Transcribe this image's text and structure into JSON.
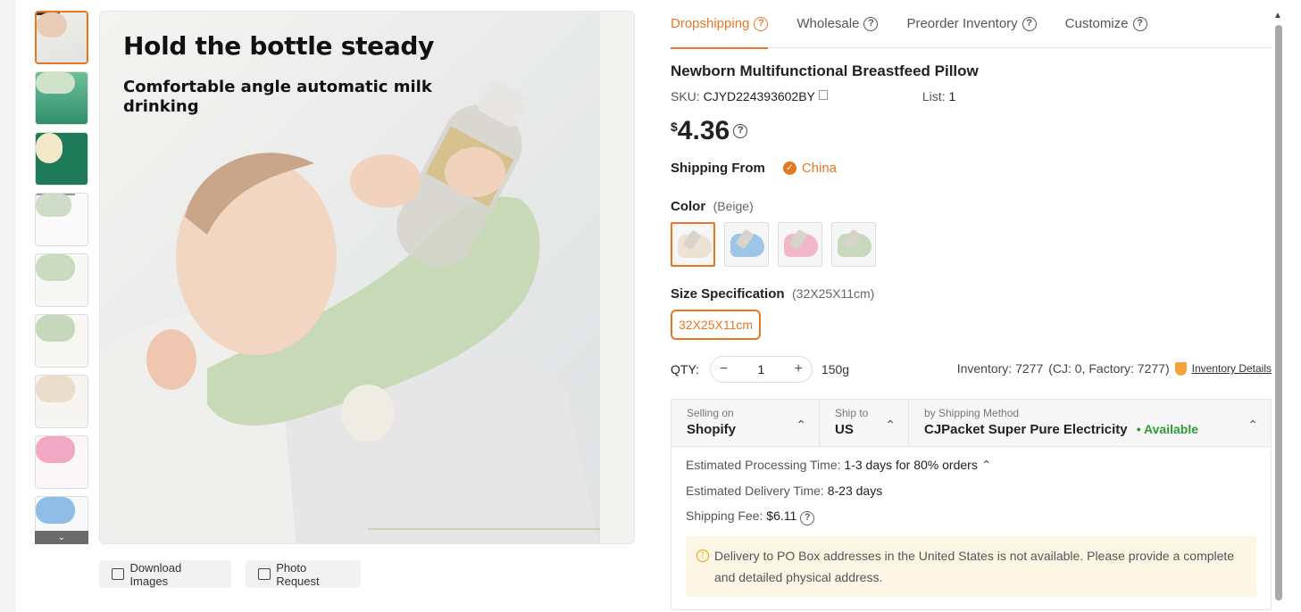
{
  "thumbnails": {
    "items": [
      "baby-bottle-holder",
      "green-pillow-shot",
      "dark-green-banner",
      "feature-sheet",
      "green-pillow-1",
      "green-pillow-2",
      "beige-pillow",
      "pink-pillow",
      "blue-pillow"
    ],
    "more_icon": "chevron-down-icon"
  },
  "main_image": {
    "headline": "Hold the bottle steady",
    "subtext": "Comfortable angle automatic milk drinking"
  },
  "image_actions": {
    "download": "Download Images",
    "photo_request": "Photo Request"
  },
  "tabs": [
    {
      "label": "Dropshipping",
      "active": true
    },
    {
      "label": "Wholesale",
      "active": false
    },
    {
      "label": "Preorder Inventory",
      "active": false
    },
    {
      "label": "Customize",
      "active": false
    }
  ],
  "product": {
    "title": "Newborn Multifunctional Breastfeed Pillow",
    "sku_label": "SKU:",
    "sku": "CJYD224393602BY",
    "list_label": "List:",
    "list_value": "1",
    "currency": "$",
    "price": "4.36"
  },
  "shipping_from": {
    "label": "Shipping From",
    "value": "China"
  },
  "color": {
    "label": "Color",
    "selected": "(Beige)",
    "options": [
      {
        "name": "beige",
        "tone": "#ece3d4"
      },
      {
        "name": "blue",
        "tone": "#9ec5e8"
      },
      {
        "name": "pink",
        "tone": "#f2b7cb"
      },
      {
        "name": "green",
        "tone": "#c7d9bd"
      }
    ]
  },
  "size": {
    "label": "Size Specification",
    "selected": "(32X25X11cm)",
    "option": "32X25X11cm"
  },
  "qty": {
    "label": "QTY:",
    "minus": "−",
    "value": "1",
    "plus": "+",
    "weight": "150g",
    "inventory": "Inventory: 7277",
    "inventory_split": "(CJ: 0, Factory: 7277)",
    "inventory_link": "Inventory Details"
  },
  "shipping": {
    "selling_on_label": "Selling on",
    "selling_on": "Shopify",
    "ship_to_label": "Ship to",
    "ship_to": "US",
    "method_label": "by Shipping Method",
    "method": "CJPacket Super Pure Electricity",
    "availability": "• Available",
    "processing_label": "Estimated Processing Time:",
    "processing": "1-3 days for 80% orders",
    "delivery_label": "Estimated Delivery Time:",
    "delivery": "8-23 days",
    "fee_label": "Shipping Fee:",
    "fee": "$6.11",
    "notice": "Delivery to PO Box addresses in the United States is not available. Please provide a complete and detailed physical address."
  },
  "colors": {
    "accent": "#e87722",
    "available": "#2e9a32",
    "notice_bg": "#fdf6e5"
  }
}
